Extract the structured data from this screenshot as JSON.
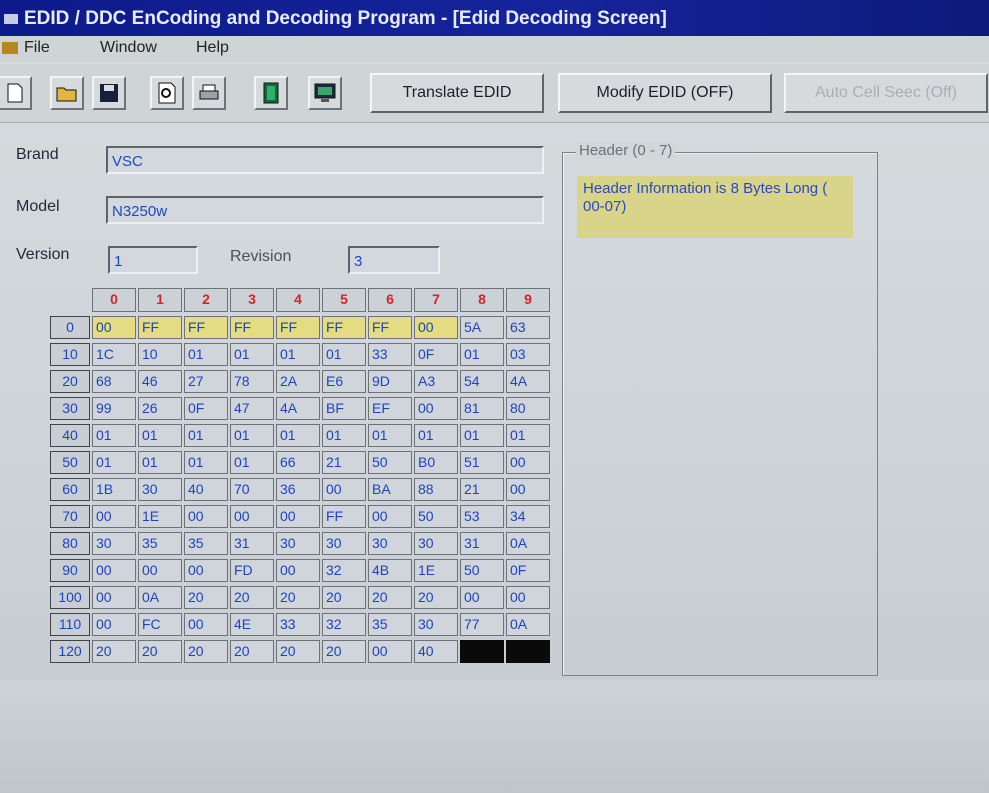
{
  "window": {
    "title": "EDID / DDC EnCoding and Decoding Program  - [Edid Decoding Screen]"
  },
  "menu": {
    "items": [
      "File",
      "Window",
      "Help"
    ]
  },
  "toolbar": {
    "icons": [
      "new-document",
      "open-folder",
      "save-disk",
      "print-preview",
      "print",
      "edid-chip",
      "monitor"
    ],
    "buttons": {
      "translate": "Translate EDID",
      "modify": "Modify EDID (OFF)",
      "auto_cell": "Auto Cell Seec (Off)"
    }
  },
  "form": {
    "brand_label": "Brand",
    "brand_value": "VSC",
    "model_label": "Model",
    "model_value": "N3250w",
    "version_label": "Version",
    "version_value": "1",
    "revision_label": "Revision",
    "revision_value": "3"
  },
  "hex_table": {
    "columns": [
      "0",
      "1",
      "2",
      "3",
      "4",
      "5",
      "6",
      "7",
      "8",
      "9"
    ],
    "rows": [
      {
        "offset": "0",
        "cells": [
          "00",
          "FF",
          "FF",
          "FF",
          "FF",
          "FF",
          "FF",
          "00",
          "5A",
          "63"
        ]
      },
      {
        "offset": "10",
        "cells": [
          "1C",
          "10",
          "01",
          "01",
          "01",
          "01",
          "33",
          "0F",
          "01",
          "03"
        ]
      },
      {
        "offset": "20",
        "cells": [
          "68",
          "46",
          "27",
          "78",
          "2A",
          "E6",
          "9D",
          "A3",
          "54",
          "4A"
        ]
      },
      {
        "offset": "30",
        "cells": [
          "99",
          "26",
          "0F",
          "47",
          "4A",
          "BF",
          "EF",
          "00",
          "81",
          "80"
        ]
      },
      {
        "offset": "40",
        "cells": [
          "01",
          "01",
          "01",
          "01",
          "01",
          "01",
          "01",
          "01",
          "01",
          "01"
        ]
      },
      {
        "offset": "50",
        "cells": [
          "01",
          "01",
          "01",
          "01",
          "66",
          "21",
          "50",
          "B0",
          "51",
          "00"
        ]
      },
      {
        "offset": "60",
        "cells": [
          "1B",
          "30",
          "40",
          "70",
          "36",
          "00",
          "BA",
          "88",
          "21",
          "00"
        ]
      },
      {
        "offset": "70",
        "cells": [
          "00",
          "1E",
          "00",
          "00",
          "00",
          "FF",
          "00",
          "50",
          "53",
          "34"
        ]
      },
      {
        "offset": "80",
        "cells": [
          "30",
          "35",
          "35",
          "31",
          "30",
          "30",
          "30",
          "30",
          "31",
          "0A"
        ]
      },
      {
        "offset": "90",
        "cells": [
          "00",
          "00",
          "00",
          "FD",
          "00",
          "32",
          "4B",
          "1E",
          "50",
          "0F"
        ]
      },
      {
        "offset": "100",
        "cells": [
          "00",
          "0A",
          "20",
          "20",
          "20",
          "20",
          "20",
          "20",
          "00",
          "00"
        ]
      },
      {
        "offset": "110",
        "cells": [
          "00",
          "FC",
          "00",
          "4E",
          "33",
          "32",
          "35",
          "30",
          "77",
          "0A"
        ]
      },
      {
        "offset": "120",
        "cells": [
          "20",
          "20",
          "20",
          "20",
          "20",
          "20",
          "00",
          "40",
          "",
          ""
        ]
      }
    ]
  },
  "header_panel": {
    "title": "Header (0 - 7)",
    "info": "Header Information is 8 Bytes Long ( 00-07)"
  },
  "colors": {
    "title_bar": "#0e1a8a",
    "highlight": "#e4dc82",
    "hex_text": "#1d44c0",
    "column_header_text": "#d4242b"
  }
}
